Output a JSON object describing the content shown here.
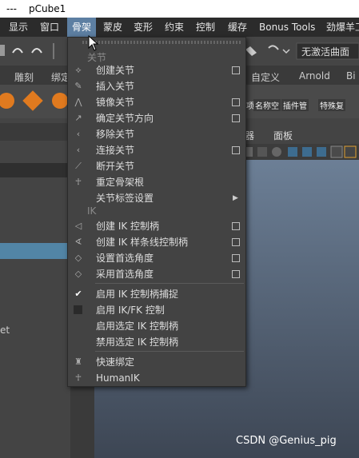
{
  "window": {
    "dash": "---",
    "title": "pCube1"
  },
  "menubar": {
    "items": [
      {
        "label": "显示"
      },
      {
        "label": "窗口"
      },
      {
        "label": "骨架"
      },
      {
        "label": "蒙皮"
      },
      {
        "label": "变形"
      },
      {
        "label": "约束"
      },
      {
        "label": "控制"
      },
      {
        "label": "缓存"
      },
      {
        "label": "Bonus Tools"
      },
      {
        "label": "劲爆羊工"
      }
    ],
    "active": "骨架"
  },
  "toolbar": {
    "combo_value": "无激活曲面"
  },
  "shelf": {
    "tabs": [
      {
        "label": "雕刻"
      },
      {
        "label": "绑定"
      },
      {
        "label": "自定义"
      },
      {
        "label": "Arnold"
      },
      {
        "label": "Bi"
      }
    ],
    "buttons": [
      {
        "label": "名称空"
      },
      {
        "label": "插件管"
      },
      {
        "label": "特殊复"
      }
    ],
    "partial_left": "项"
  },
  "viewport_menu": {
    "items": [
      {
        "label": "器"
      },
      {
        "label": "面板"
      }
    ]
  },
  "left_panel": {
    "partial_text": "et"
  },
  "dropdown": {
    "section_joints": "关节",
    "section_ik": "IK",
    "items": [
      {
        "label": "创建关节"
      },
      {
        "label": "插入关节"
      },
      {
        "label": "镜像关节"
      },
      {
        "label": "确定关节方向"
      },
      {
        "label": "移除关节"
      },
      {
        "label": "连接关节"
      },
      {
        "label": "断开关节"
      },
      {
        "label": "重定骨架根"
      },
      {
        "label": "关节标签设置"
      },
      {
        "label": "创建 IK 控制柄"
      },
      {
        "label": "创建 IK 样条线控制柄"
      },
      {
        "label": "设置首选角度"
      },
      {
        "label": "采用首选角度"
      },
      {
        "label": "启用 IK 控制柄捕捉"
      },
      {
        "label": "启用 IK/FK 控制"
      },
      {
        "label": "启用选定 IK 控制柄"
      },
      {
        "label": "禁用选定 IK 控制柄"
      },
      {
        "label": "快速绑定"
      },
      {
        "label": "HumanIK"
      }
    ],
    "check_mark": "✔"
  },
  "watermark": "CSDN @Genius_pig"
}
